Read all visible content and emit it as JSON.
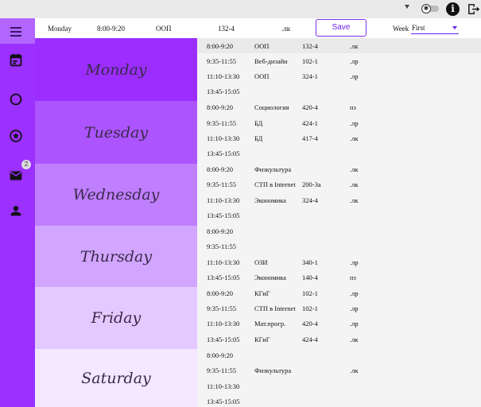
{
  "topbar": {
    "toggle_symbol": "✱",
    "info_symbol": "i",
    "icons": [
      "dropdown-arrow-icon",
      "theme-toggle-icon",
      "info-icon",
      "logout-icon"
    ]
  },
  "sidebar": {
    "badge_count": "2",
    "icons": [
      "menu-icon",
      "calendar-icon",
      "circle-icon",
      "star-icon",
      "mail-icon",
      "person-icon"
    ]
  },
  "header": {
    "day": "Monday",
    "time": "8:00-9:20",
    "subject": "ООП",
    "room": "132-4",
    "type": ".лк",
    "save_label": "Save",
    "week_label": "Week",
    "week_value": "First"
  },
  "days": [
    "Monday",
    "Tuesday",
    "Wednesday",
    "Thursday",
    "Friday",
    "Saturday"
  ],
  "schedule": [
    {
      "time": "8:00-9:20",
      "subject": "ООП",
      "room": "132-4",
      "type": ".лк"
    },
    {
      "time": "9:35-11:55",
      "subject": "Веб-дизайн",
      "room": "102-1",
      "type": ".лр"
    },
    {
      "time": "11:10-13:30",
      "subject": "ООП",
      "room": "324-1",
      "type": ".лр"
    },
    {
      "time": "13:45-15:05",
      "subject": "",
      "room": "",
      "type": ""
    },
    {
      "time": "8:00-9:20",
      "subject": "Социология",
      "room": "420-4",
      "type": "пз"
    },
    {
      "time": "9:35-11:55",
      "subject": "БД",
      "room": "424-1",
      "type": ".лр"
    },
    {
      "time": "11:10-13:30",
      "subject": "БД",
      "room": "417-4",
      "type": ".лк"
    },
    {
      "time": "13:45-15:05",
      "subject": "",
      "room": "",
      "type": ""
    },
    {
      "time": "8:00-9:20",
      "subject": "Физкультура",
      "room": "",
      "type": ".лк"
    },
    {
      "time": "9:35-11:55",
      "subject": "СТП в Internet",
      "room": "200-3а",
      "type": ".лк"
    },
    {
      "time": "11:10-13:30",
      "subject": "Экономика",
      "room": "324-4",
      "type": ".лк"
    },
    {
      "time": "13:45-15:05",
      "subject": "",
      "room": "",
      "type": ""
    },
    {
      "time": "8:00-9:20",
      "subject": "",
      "room": "",
      "type": ""
    },
    {
      "time": "9:35-11:55",
      "subject": "",
      "room": "",
      "type": ""
    },
    {
      "time": "11:10-13:30",
      "subject": "ОЗИ",
      "room": "340-1",
      "type": ".лр"
    },
    {
      "time": "13:45-15:05",
      "subject": "Экономика",
      "room": "140-4",
      "type": "пз"
    },
    {
      "time": "8:00-9:20",
      "subject": "КГиГ",
      "room": "102-1",
      "type": ".лр"
    },
    {
      "time": "9:35-11:55",
      "subject": "СТП в Internet",
      "room": "102-1",
      "type": ".лр"
    },
    {
      "time": "11:10-13:30",
      "subject": "Мат.прогр.",
      "room": "420-4",
      "type": ".лр"
    },
    {
      "time": "13:45-15:05",
      "subject": "КГиГ",
      "room": "424-4",
      "type": ".лк"
    },
    {
      "time": "8:00-9:20",
      "subject": "",
      "room": "",
      "type": ""
    },
    {
      "time": "9:35-11:55",
      "subject": "Физкультура",
      "room": "",
      "type": ".лк"
    },
    {
      "time": "11:10-13:30",
      "subject": "",
      "room": "",
      "type": ""
    },
    {
      "time": "13:45-15:05",
      "subject": "",
      "room": "",
      "type": ""
    }
  ],
  "colors": {
    "sidebar": "#9b30ff",
    "accent": "#7b2ff0",
    "day_backgrounds": [
      "#9b2eff",
      "#ac55ff",
      "#c07fff",
      "#d2a6ff",
      "#e3c9ff",
      "#f3e8ff"
    ]
  }
}
